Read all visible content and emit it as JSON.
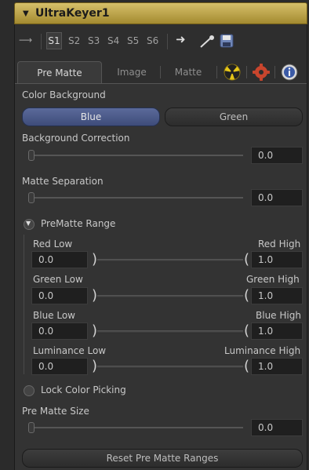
{
  "header": {
    "title": "UltraKeyer1"
  },
  "toolbar": {
    "slots": [
      "S1",
      "S2",
      "S3",
      "S4",
      "S5",
      "S6"
    ]
  },
  "tabs": [
    "Pre Matte",
    "Image",
    "Matte"
  ],
  "sections": {
    "color_background": "Color Background",
    "background_correction": "Background Correction",
    "matte_separation": "Matte Separation",
    "prematte_range": "PreMatte Range",
    "lock_color_picking": "Lock Color Picking",
    "pre_matte_size": "Pre Matte Size"
  },
  "color_options": [
    "Blue",
    "Green"
  ],
  "values": {
    "background_correction": "0.0",
    "matte_separation": "0.0",
    "pre_matte_size": "0.0"
  },
  "ranges": [
    {
      "low_label": "Red Low",
      "high_label": "Red High",
      "low": "0.0",
      "high": "1.0"
    },
    {
      "low_label": "Green Low",
      "high_label": "Green High",
      "low": "0.0",
      "high": "1.0"
    },
    {
      "low_label": "Blue Low",
      "high_label": "Blue High",
      "low": "0.0",
      "high": "1.0"
    },
    {
      "low_label": "Luminance Low",
      "high_label": "Luminance High",
      "low": "0.0",
      "high": "1.0"
    }
  ],
  "reset_button": "Reset Pre Matte Ranges",
  "icons": {
    "pin": "pin-icon",
    "arrow": "arrow-right-icon",
    "picker": "eyedropper-icon",
    "save": "save-icon",
    "radioactive": "radioactive-icon",
    "gear": "gear-icon",
    "info": "info-icon"
  },
  "colors": {
    "accent_blue": "#4a5a8a",
    "header_gold": "#c8b04e"
  }
}
